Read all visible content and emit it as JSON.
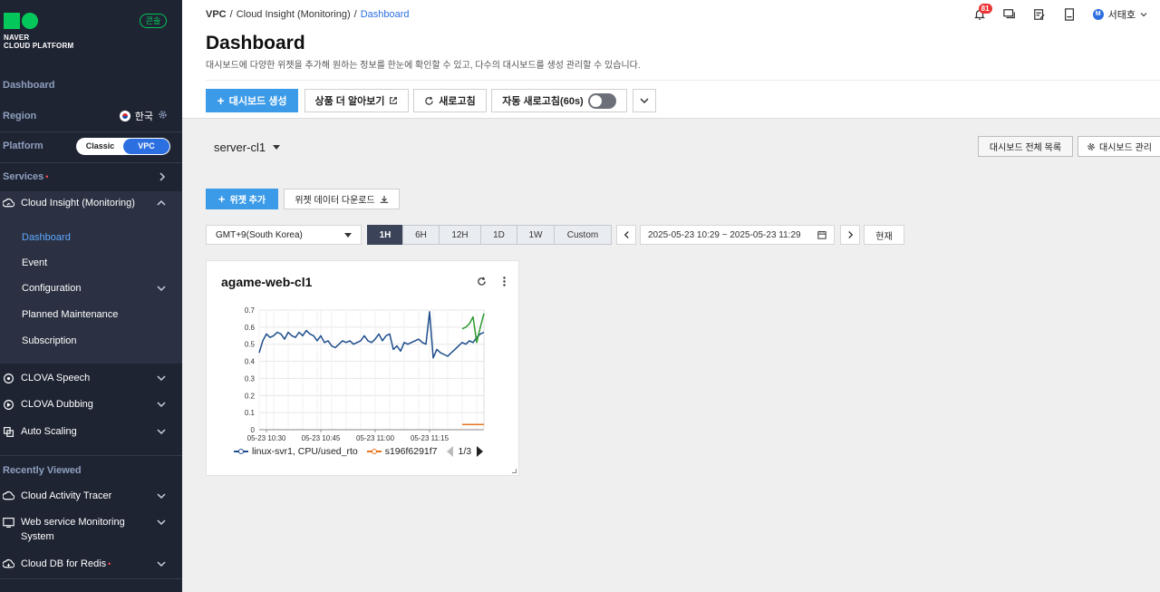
{
  "brand": {
    "logo_line1": "NAVER",
    "logo_line2": "CLOUD PLATFORM",
    "console_badge": "콘솔"
  },
  "sidebar": {
    "dashboard_label": "Dashboard",
    "region_label": "Region",
    "region_value": "한국",
    "platform_label": "Platform",
    "platform_options": [
      "Classic",
      "VPC"
    ],
    "platform_selected": "VPC",
    "services_label": "Services",
    "active_service": {
      "label": "Cloud Insight (Monitoring)"
    },
    "sub_items": [
      {
        "label": "Dashboard",
        "active": true
      },
      {
        "label": "Event"
      },
      {
        "label": "Configuration"
      },
      {
        "label": "Planned Maintenance"
      },
      {
        "label": "Subscription"
      }
    ],
    "services": [
      {
        "label": "CLOVA Speech"
      },
      {
        "label": "CLOVA Dubbing"
      },
      {
        "label": "Auto Scaling"
      }
    ],
    "recently_viewed_label": "Recently Viewed",
    "recent": [
      {
        "label": "Cloud Activity Tracer"
      },
      {
        "label_line1": "Web service Monitoring",
        "label_line2": "System"
      },
      {
        "label": "Cloud DB for Redis"
      }
    ]
  },
  "header": {
    "breadcrumb": [
      "VPC",
      "Cloud Insight (Monitoring)",
      "Dashboard"
    ],
    "notification_count": "81",
    "user_initial": "M",
    "user_name": "서태호",
    "title": "Dashboard",
    "description": "대시보드에 다양한 위젯을 추가해 원하는 정보를 한눈에 확인할 수 있고, 다수의 대시보드를 생성 관리할 수 있습니다.",
    "buttons": {
      "create": "대시보드 생성",
      "learn_more": "상품 더 알아보기",
      "refresh": "새로고침",
      "auto_refresh": "자동 새로고침(60s)"
    },
    "auto_refresh_on": false
  },
  "content": {
    "dashboard_name": "server-cl1",
    "list_button": "대시보드 전체 목록",
    "manage_button": "대시보드 관리",
    "add_widget": "위젯 추가",
    "download": "위젯 데이터 다운로드",
    "timezone": "GMT+9(South Korea)",
    "ranges": [
      "1H",
      "6H",
      "12H",
      "1D",
      "1W",
      "Custom"
    ],
    "range_selected": "1H",
    "date_range": "2025-05-23 10:29 ~ 2025-05-23 11:29",
    "now_button": "현재"
  },
  "widget": {
    "title": "agame-web-cl1",
    "legend_page": "1/3"
  },
  "colors": {
    "accent": "#3b9be8",
    "sidebar_bg": "#1f2433",
    "series_blue": "#1f4e8c",
    "series_orange": "#e8741e",
    "series_green": "#2e9a2e"
  },
  "chart_data": {
    "type": "line",
    "ylim": [
      0,
      0.7
    ],
    "y_ticks": [
      "0",
      "0.1",
      "0.2",
      "0.3",
      "0.4",
      "0.5",
      "0.6",
      "0.7"
    ],
    "x_ticks": [
      "05-23 10:30",
      "05-23 10:45",
      "05-23 11:00",
      "05-23 11:15"
    ],
    "series": [
      {
        "name": "linux-svr1, CPU/used_rto",
        "color": "#1f4e8c",
        "values": [
          0.45,
          0.52,
          0.56,
          0.54,
          0.55,
          0.57,
          0.56,
          0.53,
          0.57,
          0.55,
          0.54,
          0.57,
          0.55,
          0.58,
          0.56,
          0.55,
          0.52,
          0.55,
          0.51,
          0.52,
          0.49,
          0.48,
          0.5,
          0.52,
          0.51,
          0.52,
          0.5,
          0.51,
          0.52,
          0.55,
          0.52,
          0.51,
          0.53,
          0.56,
          0.52,
          0.55,
          0.56,
          0.47,
          0.49,
          0.46,
          0.51,
          0.5,
          0.51,
          0.52,
          0.53,
          0.51,
          0.5,
          0.69,
          0.42,
          0.47,
          0.45,
          0.44,
          0.43,
          0.45,
          0.47,
          0.49,
          0.51,
          0.5,
          0.52,
          0.51,
          0.54,
          0.56,
          0.57
        ]
      },
      {
        "name": "s196f6291f7",
        "color": "#e8741e",
        "values": [
          null,
          null,
          null,
          null,
          null,
          null,
          null,
          null,
          null,
          null,
          null,
          null,
          null,
          null,
          null,
          null,
          null,
          null,
          null,
          null,
          null,
          null,
          null,
          null,
          null,
          null,
          null,
          null,
          null,
          null,
          null,
          null,
          null,
          null,
          null,
          null,
          null,
          null,
          null,
          null,
          null,
          null,
          null,
          null,
          null,
          null,
          null,
          null,
          null,
          null,
          null,
          null,
          null,
          null,
          null,
          null,
          0.03,
          0.03,
          0.03,
          0.03,
          0.03,
          0.03,
          0.03
        ]
      },
      {
        "color": "#2e9a2e",
        "values": [
          null,
          null,
          null,
          null,
          null,
          null,
          null,
          null,
          null,
          null,
          null,
          null,
          null,
          null,
          null,
          null,
          null,
          null,
          null,
          null,
          null,
          null,
          null,
          null,
          null,
          null,
          null,
          null,
          null,
          null,
          null,
          null,
          null,
          null,
          null,
          null,
          null,
          null,
          null,
          null,
          null,
          null,
          null,
          null,
          null,
          null,
          null,
          null,
          null,
          null,
          null,
          null,
          null,
          null,
          null,
          null,
          0.59,
          0.6,
          0.62,
          0.66,
          0.51,
          0.6,
          0.68
        ]
      }
    ]
  }
}
